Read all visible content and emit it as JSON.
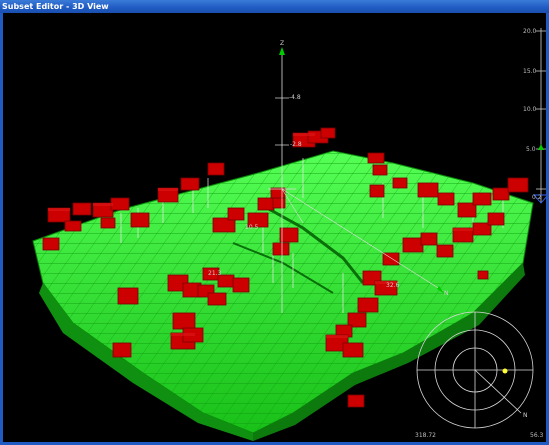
{
  "window": {
    "title": "Subset Editor - 3D View"
  },
  "axis": {
    "z_label": "Z",
    "n_label": "N"
  },
  "scale_bar": {
    "ticks": [
      "20.0",
      "15.0",
      "10.0",
      "5.0"
    ],
    "bottom_value": "0.2"
  },
  "annotations": [
    "-4.8",
    "-2.8",
    "10.5",
    "21.3",
    "32.6"
  ],
  "compass": {
    "n_label": "N",
    "bearing": "318.72",
    "dip": "56.3"
  },
  "colors": {
    "terrain": "#22ff22",
    "blocks": "#cc0000",
    "background": "#000000",
    "axis": "#00cc00"
  }
}
